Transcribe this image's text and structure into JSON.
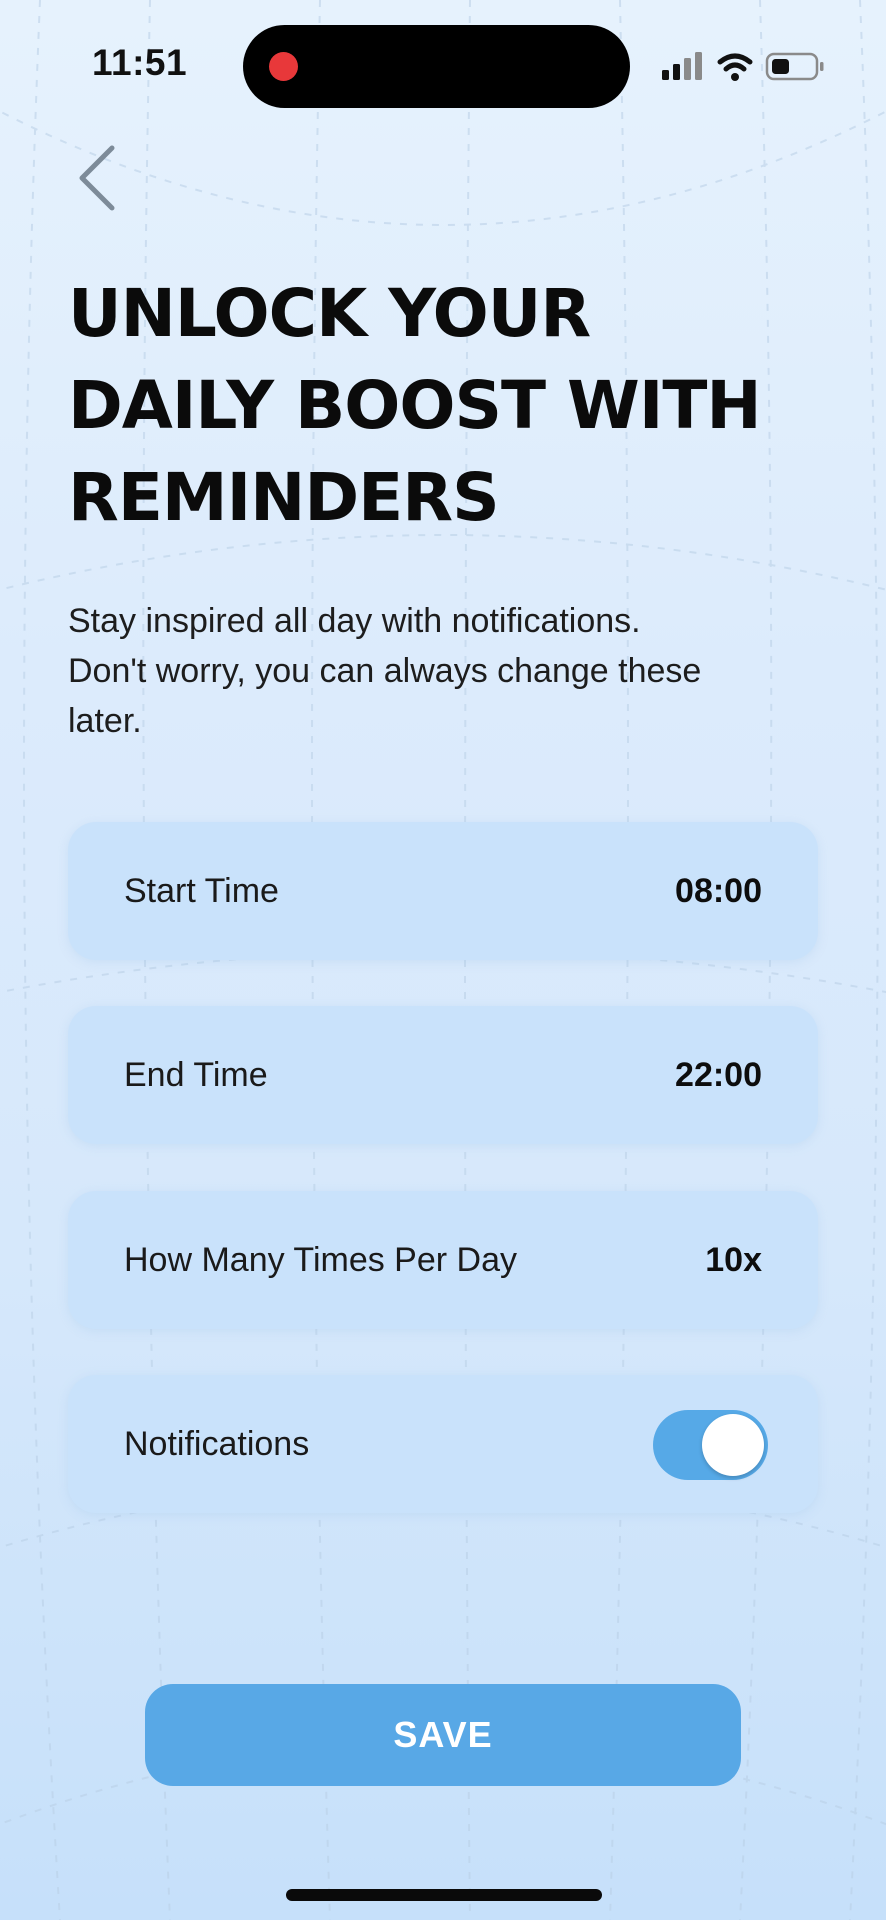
{
  "status_bar": {
    "time": "11:51",
    "icons": [
      "signal-icon",
      "wifi-icon",
      "battery-icon"
    ],
    "recording_color": "#e8383a"
  },
  "header": {
    "back_icon": "chevron-left-icon"
  },
  "main": {
    "title_lines": [
      "UNLOCK YOUR",
      "DAILY BOOST WITH",
      "REMINDERS"
    ],
    "subtitle": "Stay inspired all day with notifications. Don't worry, you can always change these later.",
    "settings": [
      {
        "label": "Start Time",
        "value": "08:00"
      },
      {
        "label": "End Time",
        "value": "22:00"
      },
      {
        "label": "How Many Times Per Day",
        "value": "10x"
      },
      {
        "label": "Notifications",
        "toggle": true
      }
    ]
  },
  "footer": {
    "save_label": "SAVE"
  },
  "colors": {
    "accent": "#58a8e6",
    "card": "#c9e2fb",
    "background": "#dcebfc"
  }
}
